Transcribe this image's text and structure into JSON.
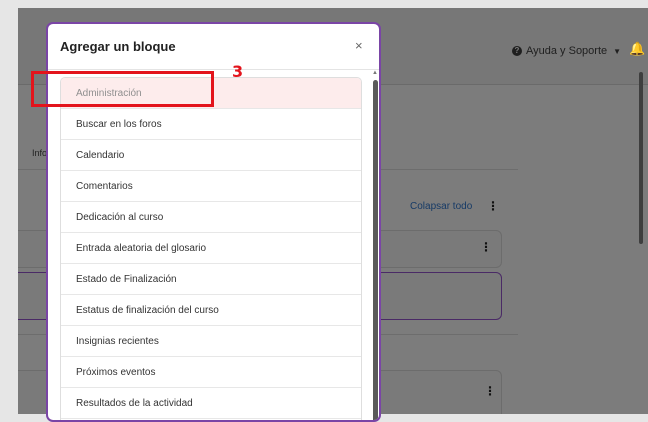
{
  "header": {
    "help_label": "Ayuda y Soporte",
    "help_icon": "question-circle-icon",
    "chevron_icon": "chevron-down-icon",
    "bell_icon": "bell-icon"
  },
  "background": {
    "info_tab": "Info",
    "collapse_all": "Colapsar todo"
  },
  "modal": {
    "title": "Agregar un bloque",
    "close": "×",
    "items": [
      "Administración",
      "Buscar en los foros",
      "Calendario",
      "Comentarios",
      "Dedicación al curso",
      "Entrada aleatoria del glosario",
      "Estado de Finalización",
      "Estatus de finalización del curso",
      "Insignias recientes",
      "Próximos eventos",
      "Resultados de la actividad"
    ]
  },
  "annotation": {
    "step_number": "3",
    "color": "#e3141c"
  },
  "colors": {
    "modal_border": "#7a45a6",
    "highlight_bg": "#fdecec",
    "link": "#163a66"
  }
}
